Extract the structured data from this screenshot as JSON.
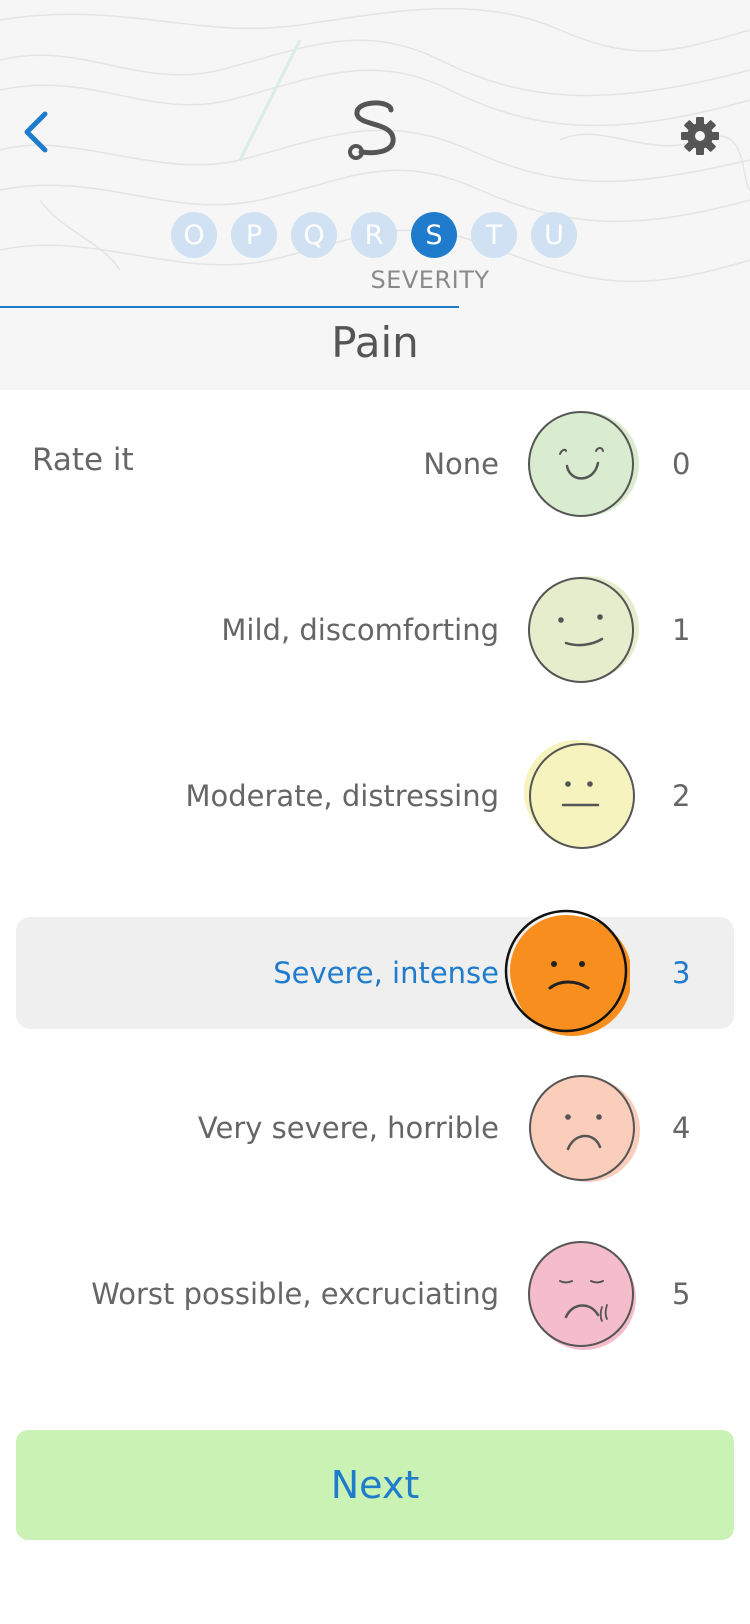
{
  "header": {
    "steps": [
      {
        "letter": "O",
        "active": false
      },
      {
        "letter": "P",
        "active": false
      },
      {
        "letter": "Q",
        "active": false
      },
      {
        "letter": "R",
        "active": false
      },
      {
        "letter": "S",
        "active": true
      },
      {
        "letter": "T",
        "active": false
      },
      {
        "letter": "U",
        "active": false
      }
    ],
    "step_label": "SEVERITY",
    "title": "Pain"
  },
  "rate_label": "Rate it",
  "options": [
    {
      "label": "None",
      "value": "0",
      "face": "smile-face-icon",
      "color": "#d9ecd0",
      "selected": false
    },
    {
      "label": "Mild, discomforting",
      "value": "1",
      "face": "slight-smile-face-icon",
      "color": "#e6edcc",
      "selected": false
    },
    {
      "label": "Moderate, distressing",
      "value": "2",
      "face": "neutral-face-icon",
      "color": "#f7f3be",
      "selected": false
    },
    {
      "label": "Severe, intense",
      "value": "3",
      "face": "frown-face-icon",
      "color": "#f78e1e",
      "selected": true
    },
    {
      "label": "Very severe,  horrible",
      "value": "4",
      "face": "sad-face-icon",
      "color": "#fbcdbb",
      "selected": false
    },
    {
      "label": "Worst possible, excruciating",
      "value": "5",
      "face": "crying-face-icon",
      "color": "#f5bdcc",
      "selected": false
    }
  ],
  "next_label": "Next",
  "colors": {
    "accent": "#1f7ccd",
    "next_bg": "#cbf2b5"
  }
}
